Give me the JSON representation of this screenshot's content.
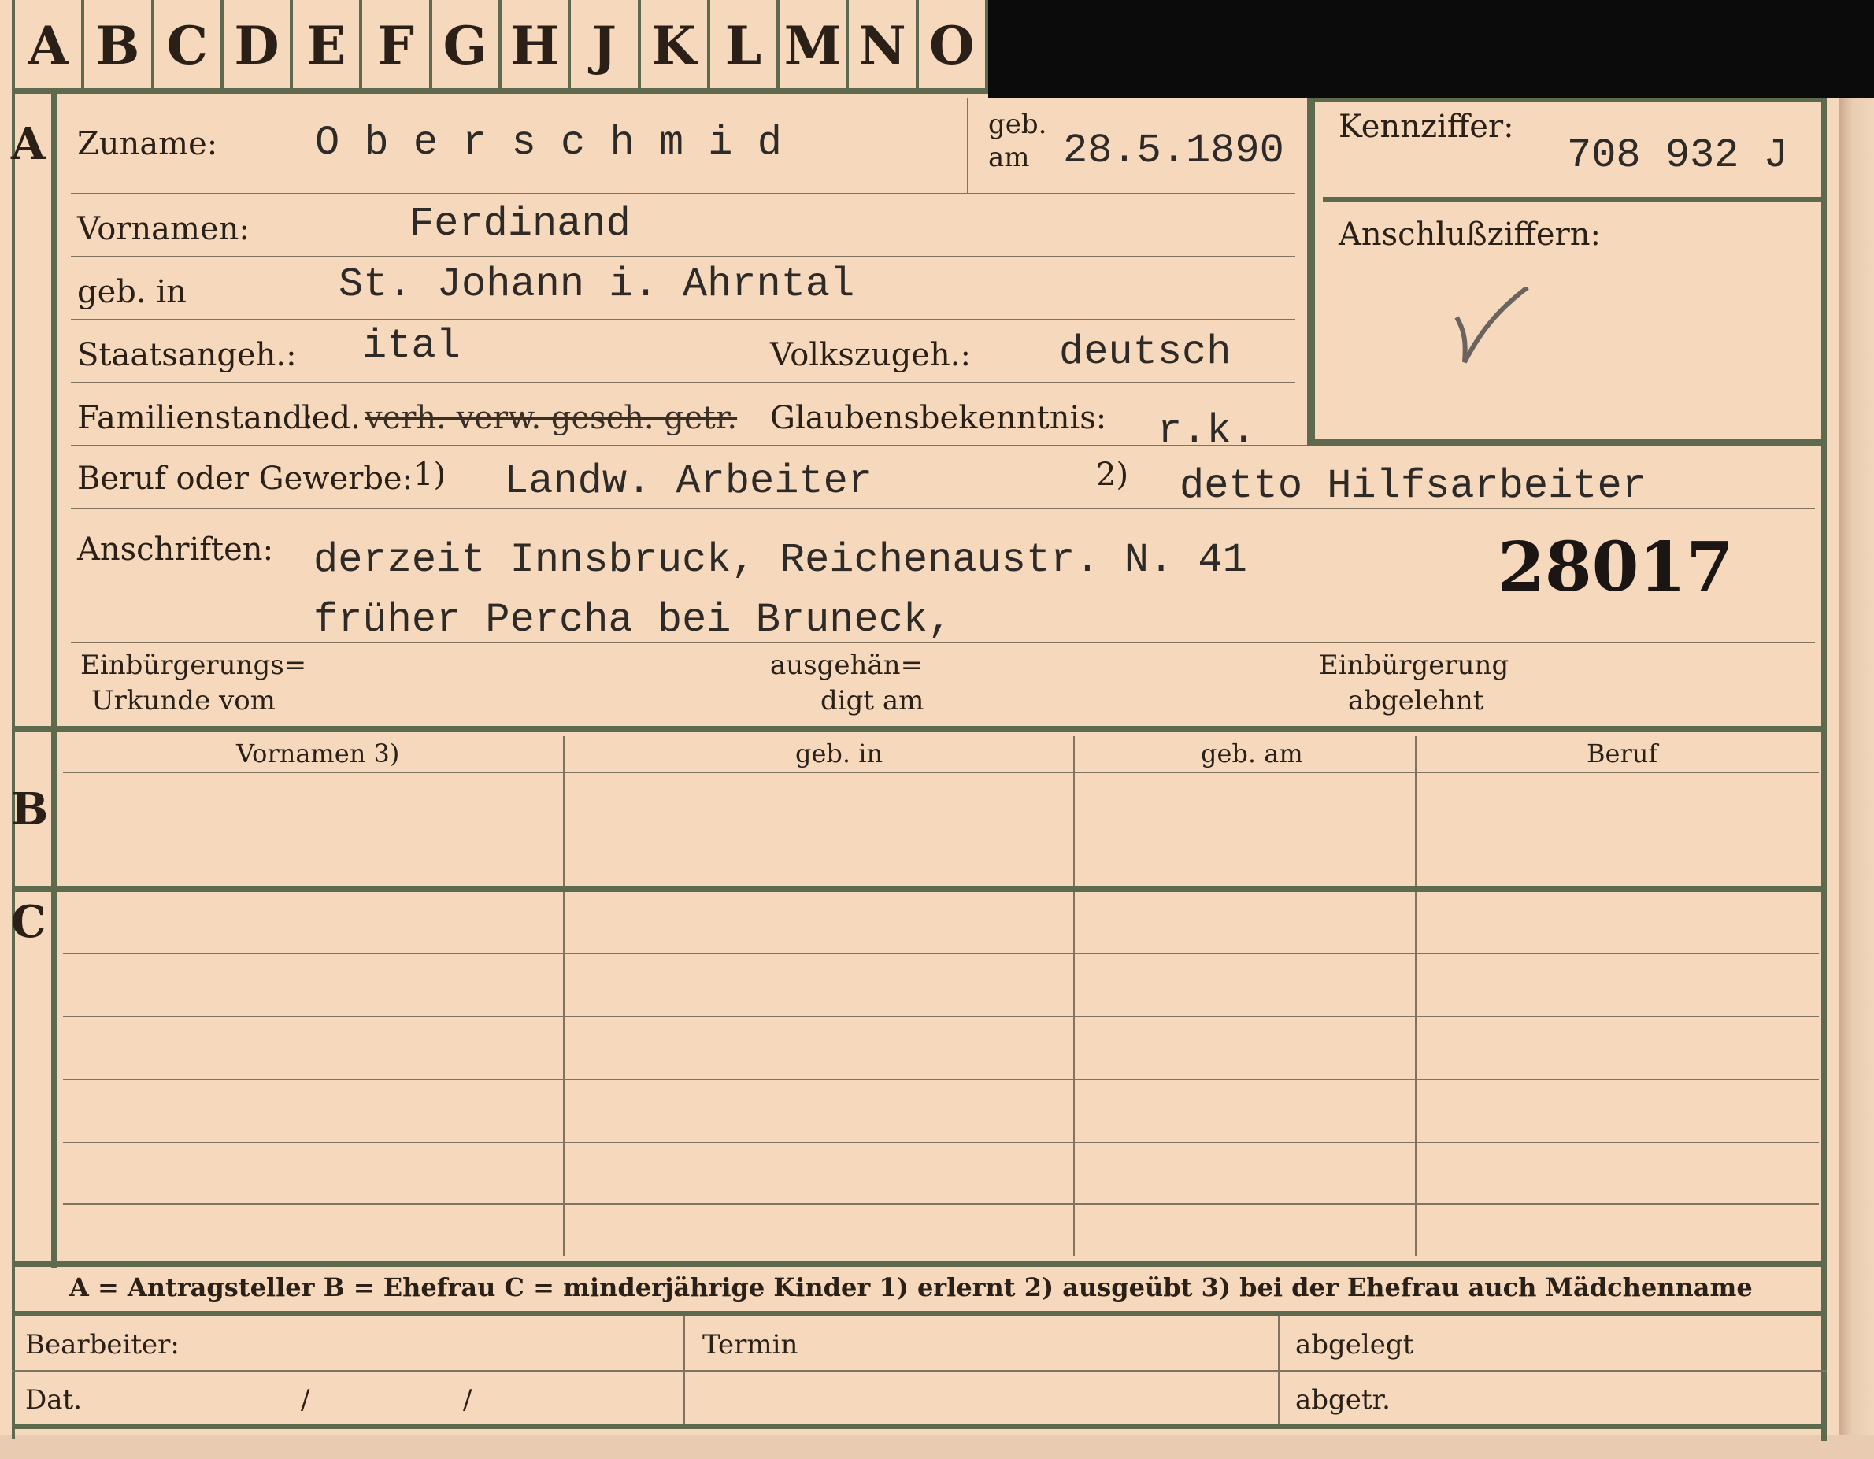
{
  "tabs": [
    "A",
    "B",
    "C",
    "D",
    "E",
    "F",
    "G",
    "H",
    "J",
    "K",
    "L",
    "M",
    "N",
    "O"
  ],
  "sections": {
    "a": "A",
    "b": "B",
    "c": "C"
  },
  "surname": {
    "label": "Zuname:",
    "value": "O b e r s c h m i d"
  },
  "birth_date": {
    "label_top": "geb.",
    "label_bottom": "am",
    "value": "28.5.1890"
  },
  "code": {
    "label": "Kennziffer:",
    "value": "708 932 J"
  },
  "connection": {
    "label": "Anschlußziffern:"
  },
  "first_names": {
    "label": "Vornamen:",
    "value": "Ferdinand"
  },
  "birthplace": {
    "label": "geb. in",
    "value": "St. Johann i. Ahrntal"
  },
  "citizenship": {
    "label": "Staatsangeh.:",
    "value": "ital"
  },
  "nationality": {
    "label": "Volkszugeh.:",
    "value": "deutsch"
  },
  "marital": {
    "label": "Familienstand:",
    "option_kept": "led.",
    "options_struck": "verh. verw. gesch. getr."
  },
  "religion": {
    "label": "Glaubensbekenntnis:",
    "value": "r.k."
  },
  "occupation": {
    "label": "Beruf oder Gewerbe:",
    "mark1": "1)",
    "value1": "Landw. Arbeiter",
    "mark2": "2)",
    "value2": "detto Hilfsarbeiter"
  },
  "addresses": {
    "label": "Anschriften:",
    "line1": "derzeit Innsbruck, Reichenaustr. N. 41",
    "line2": "früher Percha bei Bruneck,"
  },
  "file_number": "28017",
  "naturalization": {
    "cert_label_1": "Einbürgerungs=",
    "cert_label_2": "Urkunde vom",
    "handed_label_1": "ausgehän=",
    "handed_label_2": "digt am",
    "refused_label_1": "Einbürgerung",
    "refused_label_2": "abgelehnt"
  },
  "b_headers": [
    "Vornamen 3)",
    "geb. in",
    "geb. am",
    "Beruf"
  ],
  "legend": "A = Antragsteller   B = Ehefrau   C = minderjährige Kinder   1) erlernt   2) ausgeübt   3) bei der Ehefrau auch Mädchenname",
  "footer": {
    "processor": "Bearbeiter:",
    "date": "Dat.",
    "slash1": "/",
    "slash2": "/",
    "deadline": "Termin",
    "filed": "abgelegt",
    "removed": "abgetr."
  }
}
